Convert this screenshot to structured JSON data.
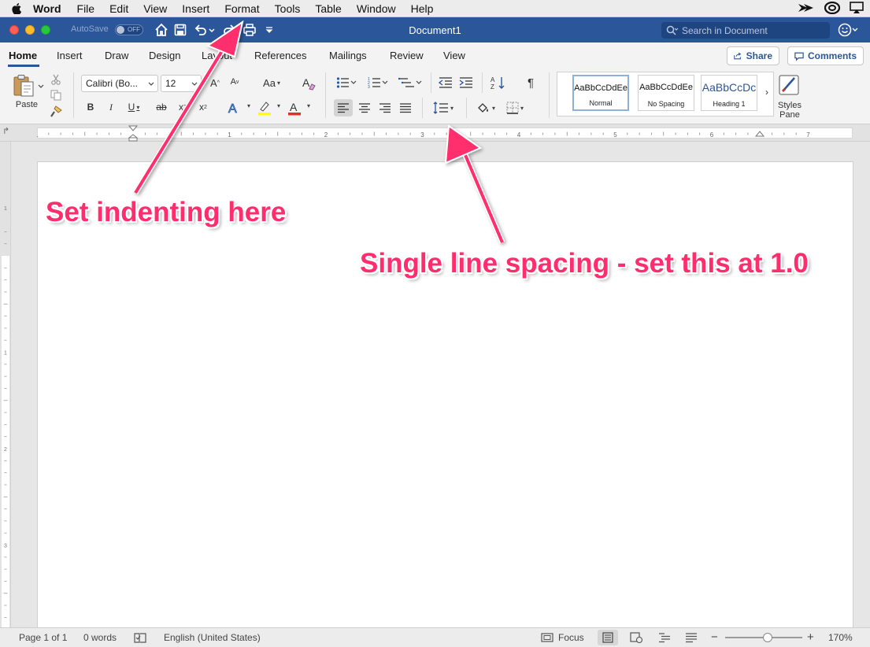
{
  "menubar": {
    "app_name": "Word",
    "items": [
      "File",
      "Edit",
      "View",
      "Insert",
      "Format",
      "Tools",
      "Table",
      "Window",
      "Help"
    ]
  },
  "titlebar": {
    "autosave_label": "AutoSave",
    "autosave_state": "OFF",
    "document_title": "Document1",
    "search_placeholder": "Search in Document"
  },
  "ribbon_tabs": [
    "Home",
    "Insert",
    "Draw",
    "Design",
    "Layout",
    "References",
    "Mailings",
    "Review",
    "View"
  ],
  "share": {
    "share_label": "Share",
    "comments_label": "Comments"
  },
  "clipboard": {
    "paste_label": "Paste"
  },
  "font": {
    "family": "Calibri (Bo...",
    "size": "12"
  },
  "styles": [
    {
      "preview": "AaBbCcDdEe",
      "name": "Normal"
    },
    {
      "preview": "AaBbCcDdEe",
      "name": "No Spacing"
    },
    {
      "preview": "AaBbCcDc",
      "name": "Heading 1"
    }
  ],
  "styles_pane": {
    "line1": "Styles",
    "line2": "Pane"
  },
  "ruler_numbers": [
    "1",
    "1",
    "2",
    "3",
    "4",
    "5",
    "6",
    "7"
  ],
  "vruler_numbers": [
    "1",
    "1",
    "2",
    "3"
  ],
  "statusbar": {
    "page": "Page 1 of 1",
    "words": "0 words",
    "language": "English (United States)",
    "focus": "Focus",
    "zoom": "170%",
    "zoom_fraction": 0.55
  },
  "annotations": {
    "indent": "Set indenting here",
    "spacing": "Single line spacing - set this at 1.0"
  },
  "colors": {
    "title_bar": "#2b579a",
    "annotation": "#ff2d6d",
    "highlight": "#ffff00",
    "font_color": "#e0302a"
  }
}
